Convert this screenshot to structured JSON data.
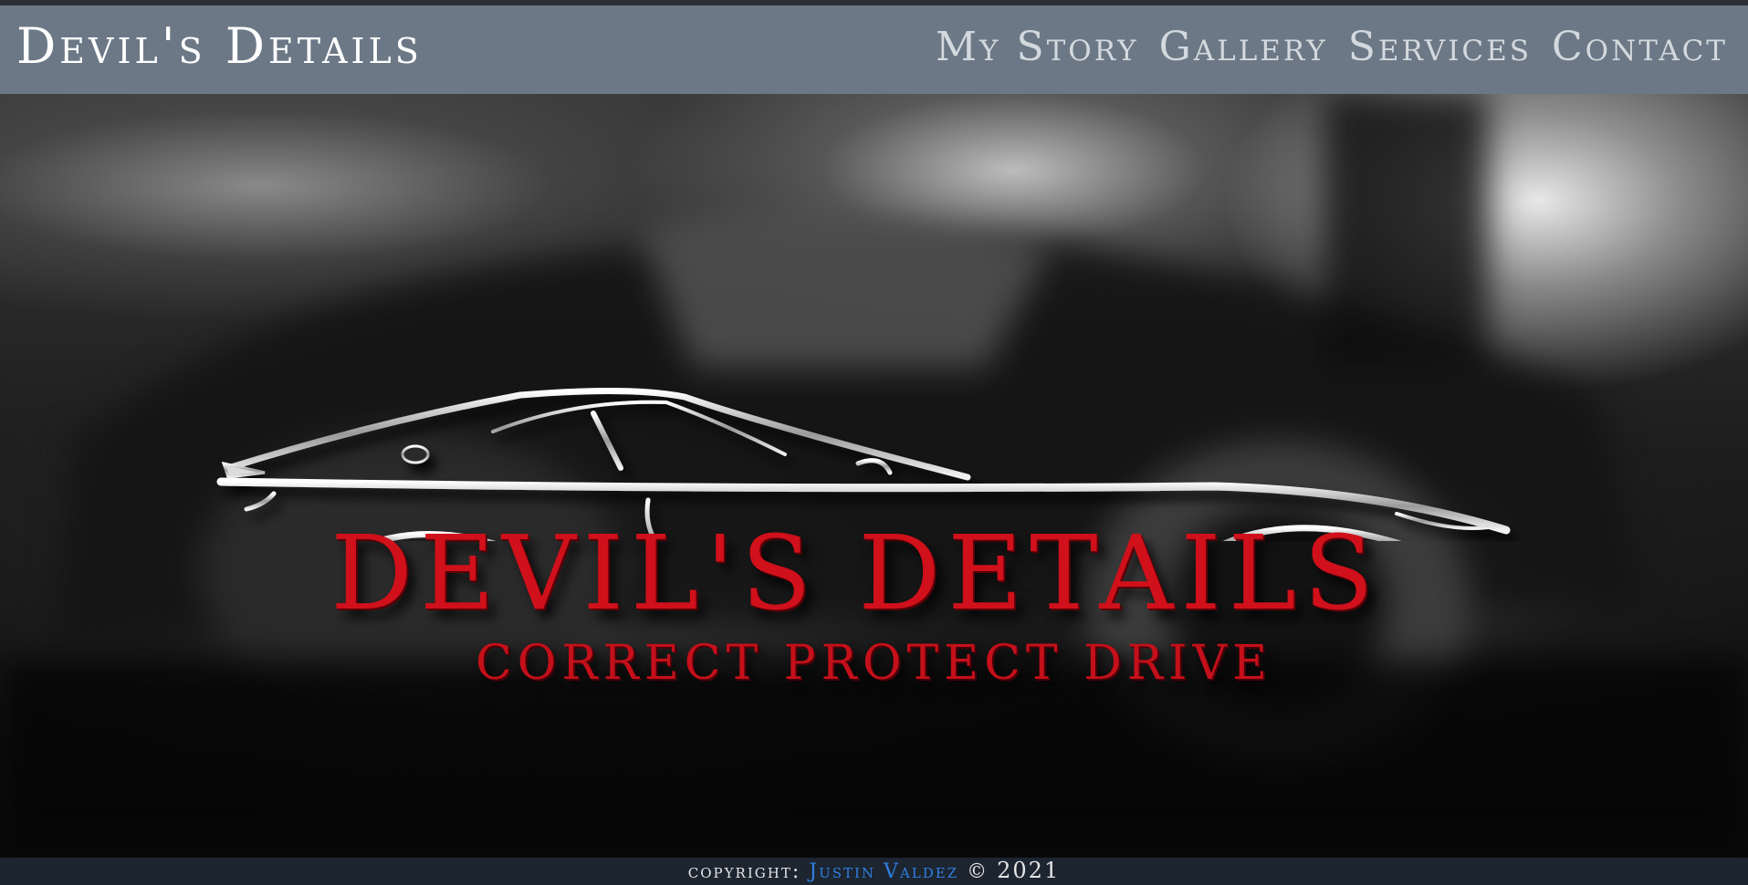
{
  "header": {
    "brand": "Devil's Details",
    "nav": [
      "My Story",
      "Gallery",
      "Services",
      "Contact"
    ]
  },
  "hero": {
    "logo_title": "DEVIL'S DETAILS",
    "logo_tagline": "CORRECT PROTECT DRIVE"
  },
  "footer": {
    "copyright_label": "copyright:",
    "author": "Justin Valdez",
    "symbol": "©",
    "year": "2021"
  },
  "colors": {
    "header_bg": "#6c7886",
    "footer_bg": "#1c2530",
    "logo_red": "#d0101a",
    "author_link": "#2f7fe0"
  },
  "icons": [
    "car-silhouette-logo-icon"
  ]
}
